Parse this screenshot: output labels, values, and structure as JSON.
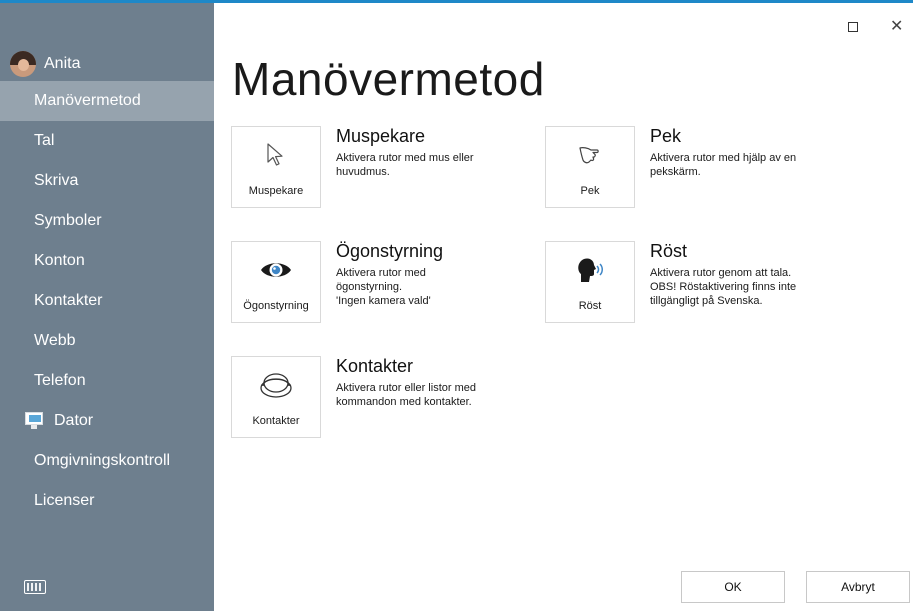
{
  "window": {
    "maximize_icon": "maximize-icon",
    "close_glyph": "✕"
  },
  "user": {
    "name": "Anita"
  },
  "sidebar": {
    "items": [
      {
        "label": "Manövermetod",
        "active": true
      },
      {
        "label": "Tal"
      },
      {
        "label": "Skriva"
      },
      {
        "label": "Symboler"
      },
      {
        "label": "Konton"
      },
      {
        "label": "Kontakter"
      },
      {
        "label": "Webb"
      },
      {
        "label": "Telefon"
      },
      {
        "label": "Dator",
        "icon": "monitor-icon"
      },
      {
        "label": "Omgivningskontroll"
      },
      {
        "label": "Licenser"
      }
    ],
    "keyboard_icon": "keyboard-icon"
  },
  "page": {
    "title": "Manövermetod"
  },
  "options": {
    "muspekare": {
      "tile_label": "Muspekare",
      "title": "Muspekare",
      "description": "Aktivera rutor med mus eller\nhuvudmus.",
      "icon": "cursor-icon"
    },
    "pek": {
      "tile_label": "Pek",
      "title": "Pek",
      "description": "Aktivera rutor med hjälp av en\npekskärm.",
      "icon": "touch-hand-icon"
    },
    "ogonstyrning": {
      "tile_label": "Ögonstyrning",
      "title": "Ögonstyrning",
      "description": "Aktivera rutor med\nögonstyrning.\n'Ingen kamera vald'",
      "icon": "eye-icon"
    },
    "rost": {
      "tile_label": "Röst",
      "title": "Röst",
      "description": "Aktivera rutor genom att tala.\nOBS! Röstaktivering finns inte\ntillgängligt på Svenska.",
      "icon": "voice-head-icon"
    },
    "kontakter": {
      "tile_label": "Kontakter",
      "title": "Kontakter",
      "description": "Aktivera rutor eller listor med\nkommandon med kontakter.",
      "icon": "switch-button-icon"
    }
  },
  "buttons": {
    "ok": "OK",
    "cancel": "Avbryt"
  },
  "colors": {
    "sidebar": "#6e7f8e",
    "sidebar_active": "#96a3ae",
    "accent": "#1e88c8"
  }
}
